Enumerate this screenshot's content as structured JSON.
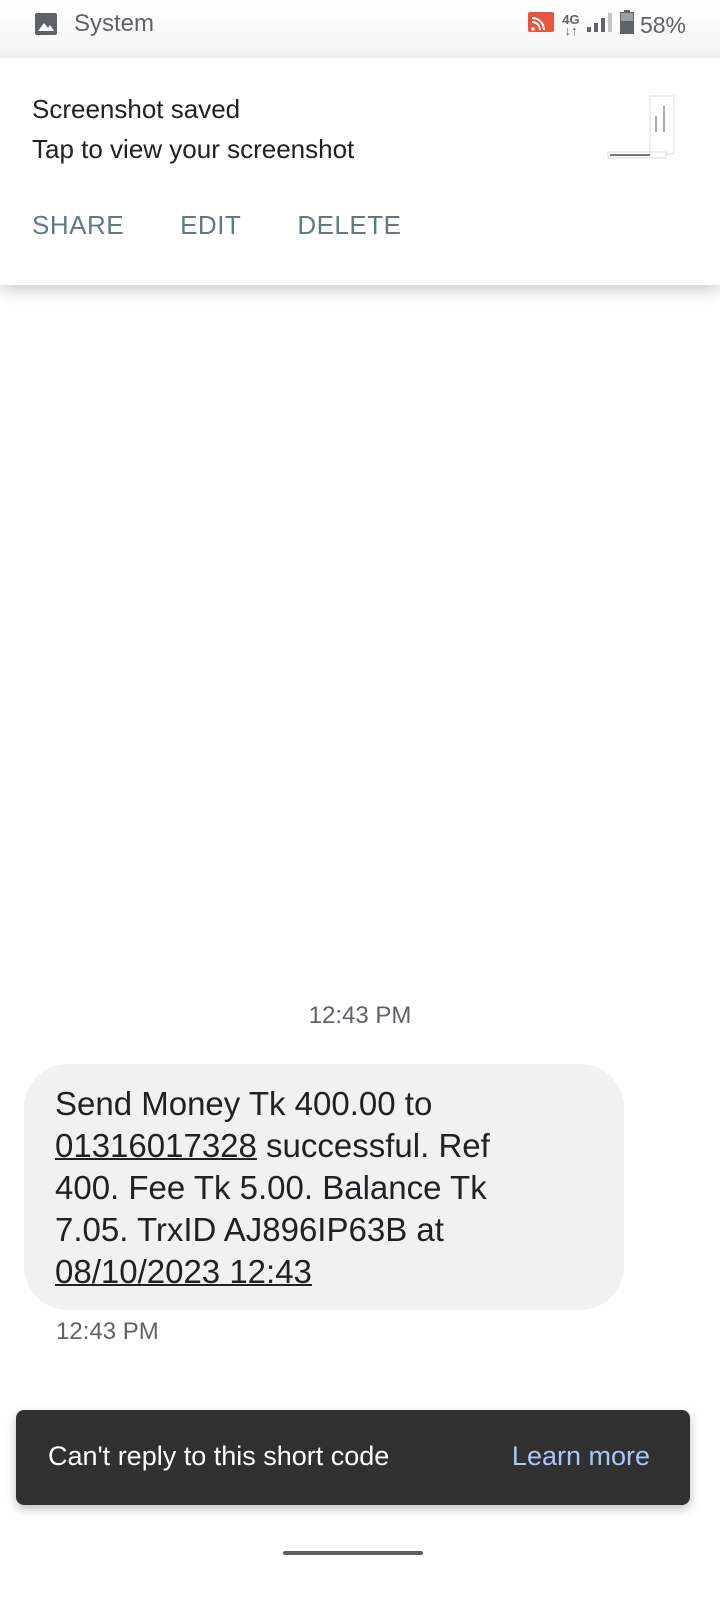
{
  "status_bar": {
    "app_icon": "image-icon",
    "app_label": "System",
    "network_label_top": "4G",
    "network_label_bottom": "↓↑",
    "battery": "58%"
  },
  "notification": {
    "title": "Screenshot saved",
    "body": "Tap to view your screenshot",
    "actions": [
      "SHARE",
      "EDIT",
      "DELETE"
    ]
  },
  "conversation": {
    "time_header": "12:43 PM",
    "message": {
      "line1": "Send Money Tk 400.00 to",
      "phone": "01316017328",
      "after_phone": " successful. Ref",
      "line3": "400. Fee Tk 5.00. Balance Tk",
      "line4": "7.05. TrxID AJ896IP63B at",
      "datetime": "08/10/2023 12:43"
    },
    "message_time": "12:43 PM"
  },
  "snackbar": {
    "text": "Can't reply to this short code",
    "action": "Learn more"
  },
  "colors": {
    "accent_action": "#5f7a87",
    "snackbar_bg": "#303030",
    "snackbar_link": "#a8c7fa",
    "bubble_bg": "#f1f1f1"
  }
}
